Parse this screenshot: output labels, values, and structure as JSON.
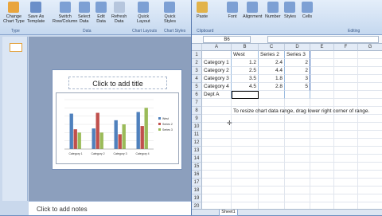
{
  "ppt": {
    "ribbon_buttons": [
      {
        "label": "Change\nChart Type",
        "color": "#e9a53d"
      },
      {
        "label": "Save As\nTemplate",
        "color": "#6b8fc9"
      },
      {
        "label": "Switch\nRow/Column",
        "color": "#7da0d4"
      },
      {
        "label": "Select\nData",
        "color": "#7da0d4"
      },
      {
        "label": "Edit\nData",
        "color": "#7da0d4"
      },
      {
        "label": "Refresh\nData",
        "color": "#b6c6dd"
      },
      {
        "label": "Quick\nLayout",
        "color": "#7da0d4"
      },
      {
        "label": "Quick\nStyles",
        "color": "#7da0d4"
      }
    ],
    "groups": [
      "Type",
      "Data",
      "Chart Layouts",
      "Chart Styles"
    ],
    "slide_title": "Click to add title",
    "notes_placeholder": "Click to add notes"
  },
  "excel": {
    "ribbon_buttons": [
      {
        "label": "Paste",
        "color": "#e2b34a"
      },
      {
        "label": "Font",
        "color": "#7da0d4"
      },
      {
        "label": "Alignment",
        "color": "#7da0d4"
      },
      {
        "label": "Number",
        "color": "#7da0d4"
      },
      {
        "label": "Styles",
        "color": "#7da0d4"
      },
      {
        "label": "Cells",
        "color": "#7da0d4"
      }
    ],
    "groups": [
      "Clipboard",
      "Editing"
    ],
    "name_box": "B6",
    "columns": [
      "A",
      "B",
      "C",
      "D",
      "E",
      "F",
      "G"
    ],
    "header_row": [
      "",
      "West",
      "Series 2",
      "Series 3"
    ],
    "rows": [
      [
        "Category 1",
        "1.2",
        "2.4",
        "2"
      ],
      [
        "Category 2",
        "2.5",
        "4.4",
        "2"
      ],
      [
        "Category 3",
        "3.5",
        "1.8",
        "3"
      ],
      [
        "Category 4",
        "4.5",
        "2.8",
        "5"
      ],
      [
        "Dept A",
        "",
        "",
        ""
      ]
    ],
    "hint": "To resize chart data range, drag lower right corner of range.",
    "sheet_tab": "Sheet1"
  },
  "chart_data": {
    "type": "bar",
    "categories": [
      "Category 1",
      "Category 2",
      "Category 3",
      "Category 4"
    ],
    "series": [
      {
        "name": "West",
        "values": [
          4.3,
          2.5,
          3.5,
          4.5
        ],
        "color": "#4f81bd"
      },
      {
        "name": "Series 2",
        "values": [
          2.4,
          4.4,
          1.8,
          2.8
        ],
        "color": "#c0504d"
      },
      {
        "name": "Series 3",
        "values": [
          2,
          2,
          3,
          5
        ],
        "color": "#9bbb59"
      }
    ],
    "ylim": [
      0,
      6
    ],
    "legend": "right"
  }
}
